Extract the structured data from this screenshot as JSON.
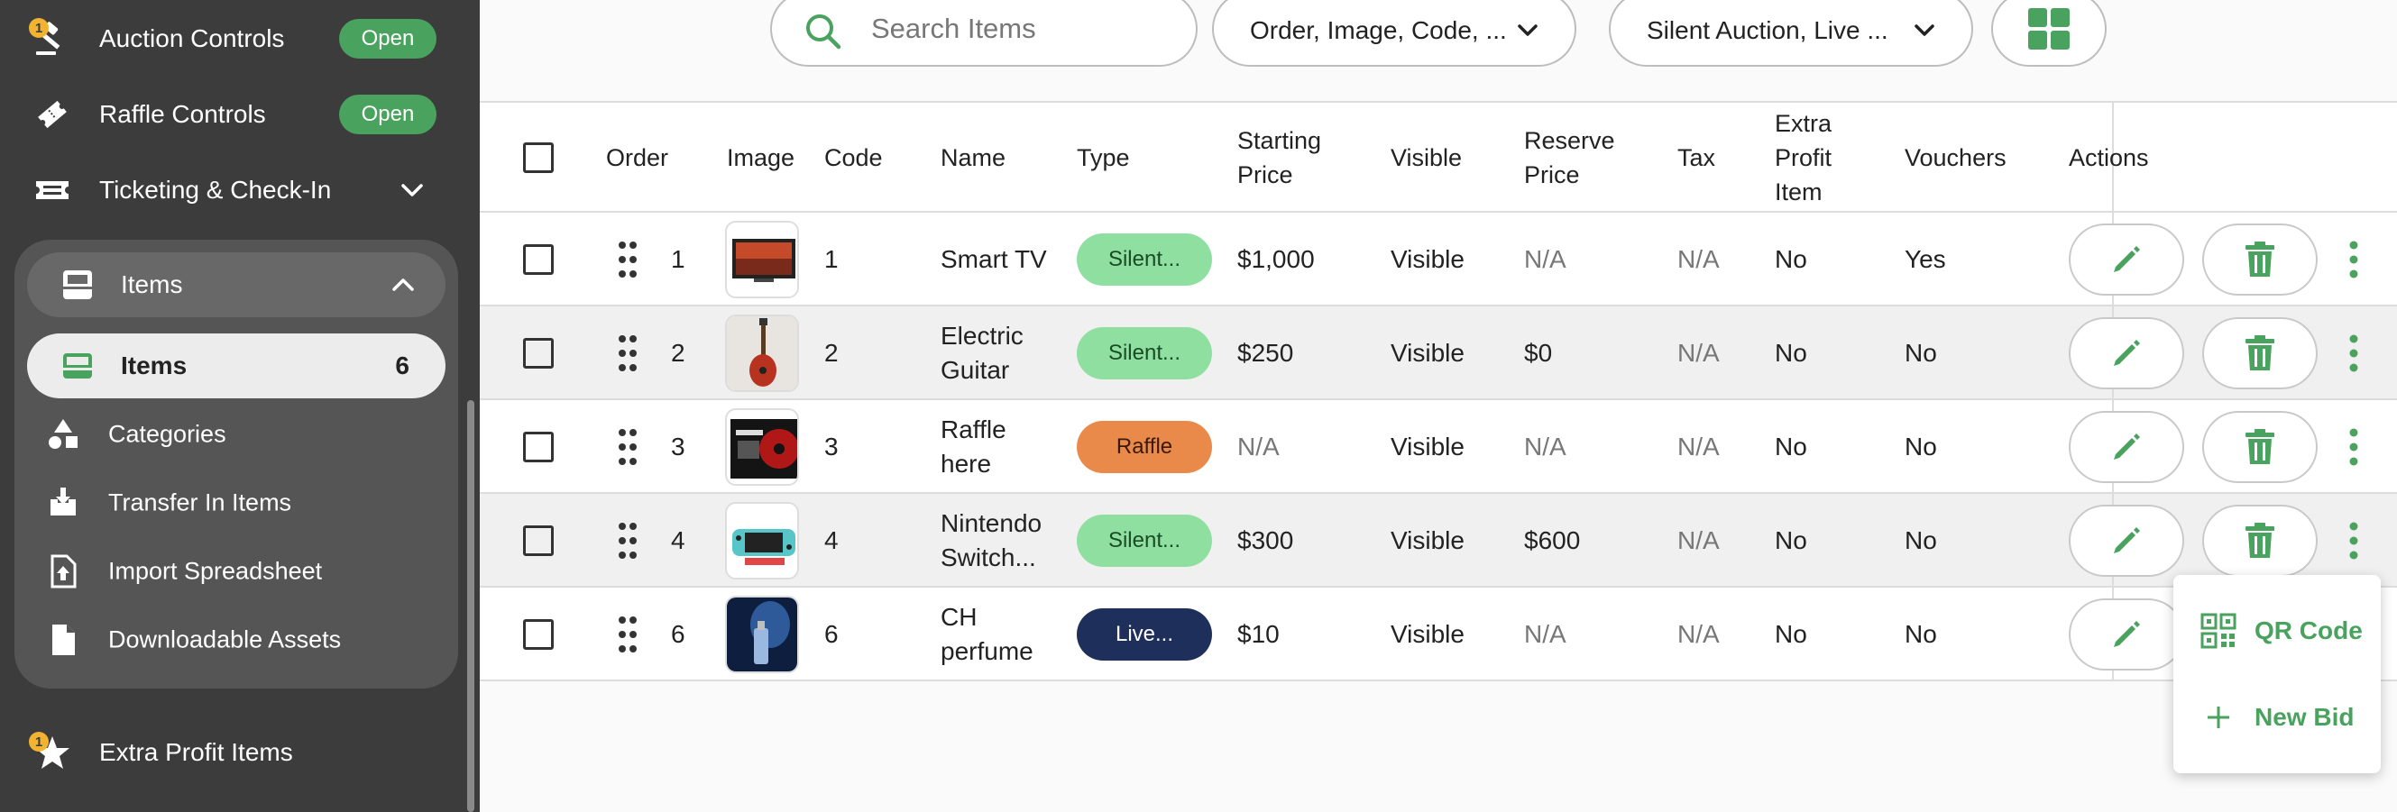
{
  "colors": {
    "sidebar_bg": "#3c3c3c",
    "accent_green": "#49a25d",
    "silent_pill": "#8fe0a0",
    "raffle_pill": "#ea8a4a",
    "live_pill": "#1f2f5c",
    "notif": "#f2b330"
  },
  "sidebar": {
    "auction_controls": {
      "label": "Auction Controls",
      "badge": "Open",
      "notif": "1",
      "icon": "gavel-icon"
    },
    "raffle_controls": {
      "label": "Raffle Controls",
      "badge": "Open",
      "icon": "ticket-icon"
    },
    "ticketing": {
      "label": "Ticketing & Check-In",
      "icon": "ticketing-icon"
    },
    "items_group": {
      "label": "Items",
      "icon": "inbox-icon",
      "active": {
        "label": "Items",
        "count": "6"
      },
      "children": [
        {
          "label": "Categories",
          "icon": "shapes-icon"
        },
        {
          "label": "Transfer In Items",
          "icon": "transfer-in-icon"
        },
        {
          "label": "Import Spreadsheet",
          "icon": "file-upload-icon"
        },
        {
          "label": "Downloadable Assets",
          "icon": "file-icon"
        }
      ]
    },
    "extra_profit": {
      "label": "Extra Profit Items",
      "notif": "1",
      "icon": "star-icon"
    }
  },
  "toolbar": {
    "search_placeholder": "Search Items",
    "columns_select": "Order, Image, Code, ...",
    "type_select": "Silent Auction, Live ..."
  },
  "table": {
    "headers": {
      "order": "Order",
      "image": "Image",
      "code": "Code",
      "name": "Name",
      "type": "Type",
      "starting_price_1": "Starting",
      "starting_price_2": "Price",
      "visible": "Visible",
      "reserve_price_1": "Reserve",
      "reserve_price_2": "Price",
      "tax": "Tax",
      "extra_1": "Extra",
      "extra_2": "Profit",
      "extra_3": "Item",
      "vouchers": "Vouchers",
      "actions": "Actions"
    },
    "rows": [
      {
        "order": "1",
        "code": "1",
        "name1": "Smart TV",
        "name2": "",
        "type": "Silent...",
        "type_kind": "silent",
        "starting": "$1,000",
        "visible": "Visible",
        "reserve": "N/A",
        "tax": "N/A",
        "extra": "No",
        "vouchers": "Yes"
      },
      {
        "order": "2",
        "code": "2",
        "name1": "Electric",
        "name2": "Guitar",
        "type": "Silent...",
        "type_kind": "silent",
        "starting": "$250",
        "visible": "Visible",
        "reserve": "$0",
        "tax": "N/A",
        "extra": "No",
        "vouchers": "No"
      },
      {
        "order": "3",
        "code": "3",
        "name1": "Raffle",
        "name2": "here",
        "type": "Raffle",
        "type_kind": "raffle",
        "starting": "N/A",
        "visible": "Visible",
        "reserve": "N/A",
        "tax": "N/A",
        "extra": "No",
        "vouchers": "No"
      },
      {
        "order": "4",
        "code": "4",
        "name1": "Nintendo",
        "name2": "Switch...",
        "type": "Silent...",
        "type_kind": "silent",
        "starting": "$300",
        "visible": "Visible",
        "reserve": "$600",
        "tax": "N/A",
        "extra": "No",
        "vouchers": "No"
      },
      {
        "order": "6",
        "code": "6",
        "name1": "CH",
        "name2": "perfume",
        "type": "Live...",
        "type_kind": "live",
        "starting": "$10",
        "visible": "Visible",
        "reserve": "N/A",
        "tax": "N/A",
        "extra": "No",
        "vouchers": "No"
      }
    ]
  },
  "popup_menu": {
    "qr": {
      "label": "QR Code",
      "icon": "qr-code-icon"
    },
    "new_bid": {
      "label": "New Bid",
      "icon": "plus-icon"
    }
  }
}
